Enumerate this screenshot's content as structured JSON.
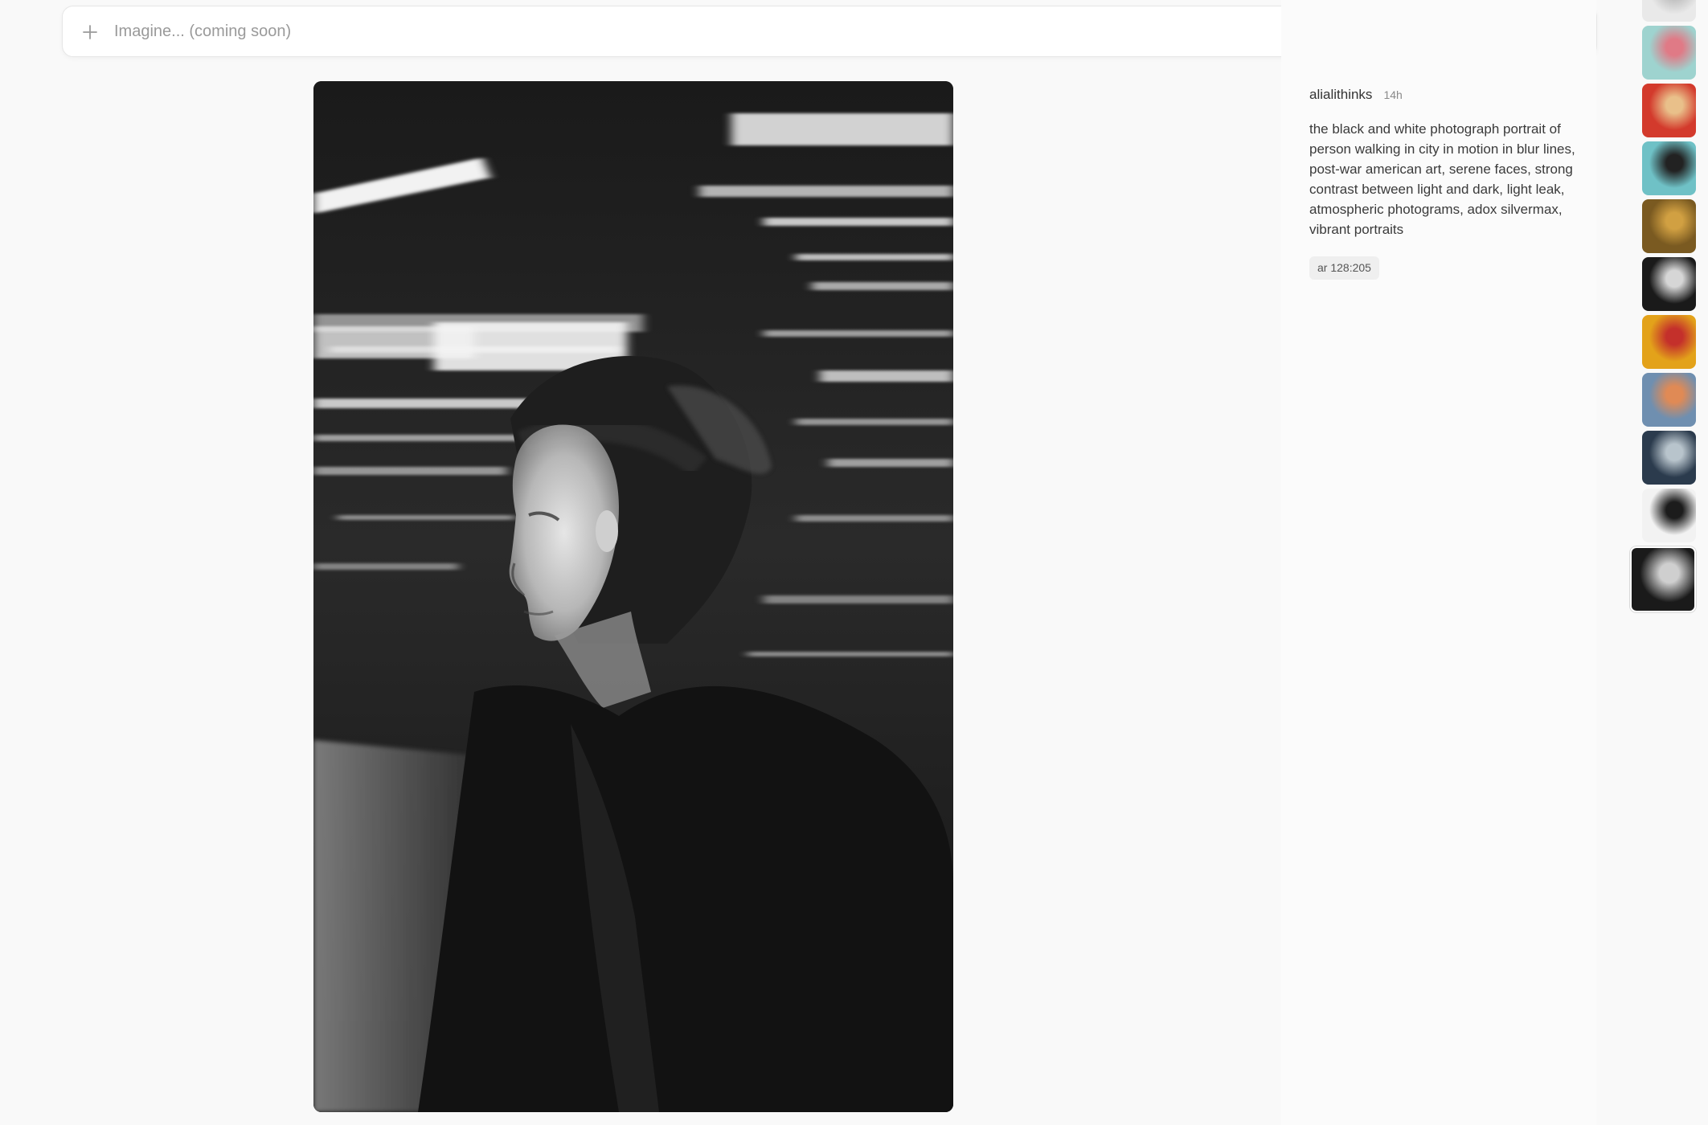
{
  "prompt_bar": {
    "placeholder": "Imagine... (coming soon)",
    "plus_icon": "plus-icon",
    "settings_icon": "sliders-icon"
  },
  "close_button": {
    "icon": "close-icon"
  },
  "post": {
    "author": "alialithinks",
    "age": "14h",
    "prompt": "the black and white photograph portrait of person walking in city in motion in blur lines, post-war american art, serene faces, strong contrast between light and dark, light leak, atmospheric photograms, adox silvermax, vibrant portraits",
    "params": "ar 128:205"
  },
  "thumbnails": [
    {
      "subject": "white floral pattern",
      "colors": [
        "#e9e9e9",
        "#bdbdbd"
      ]
    },
    {
      "subject": "teal background with pink flowers",
      "colors": [
        "#9ed3cf",
        "#e07a86"
      ]
    },
    {
      "subject": "red background with golden hand",
      "colors": [
        "#d33a2c",
        "#e9c08a"
      ]
    },
    {
      "subject": "portrait of woman with dark hair on teal",
      "colors": [
        "#6fc1c6",
        "#222222"
      ]
    },
    {
      "subject": "golden winged figure",
      "colors": [
        "#7a5a21",
        "#d1a042"
      ]
    },
    {
      "subject": "monochrome face profile",
      "colors": [
        "#1a1a1a",
        "#d6d6d6"
      ]
    },
    {
      "subject": "colorful dragon illustration",
      "colors": [
        "#e3a21a",
        "#c4302b"
      ]
    },
    {
      "subject": "blue feather with orange spine",
      "colors": [
        "#6f8fb0",
        "#e08a55"
      ]
    },
    {
      "subject": "dark blue patterned fabric",
      "colors": [
        "#2b3b4d",
        "#b8c4cc"
      ]
    },
    {
      "subject": "black eagle in white",
      "colors": [
        "#f2f2f2",
        "#1c1c1c"
      ]
    },
    {
      "subject": "black and white woman in motion",
      "colors": [
        "#1a1a1a",
        "#cfcfcf"
      ],
      "selected": true
    }
  ],
  "colors": {
    "background": "#f9f9f9",
    "panel": "#fbfbfb",
    "text": "#3a3a3a",
    "muted": "#8a8a8a",
    "badge": "#efefef"
  }
}
